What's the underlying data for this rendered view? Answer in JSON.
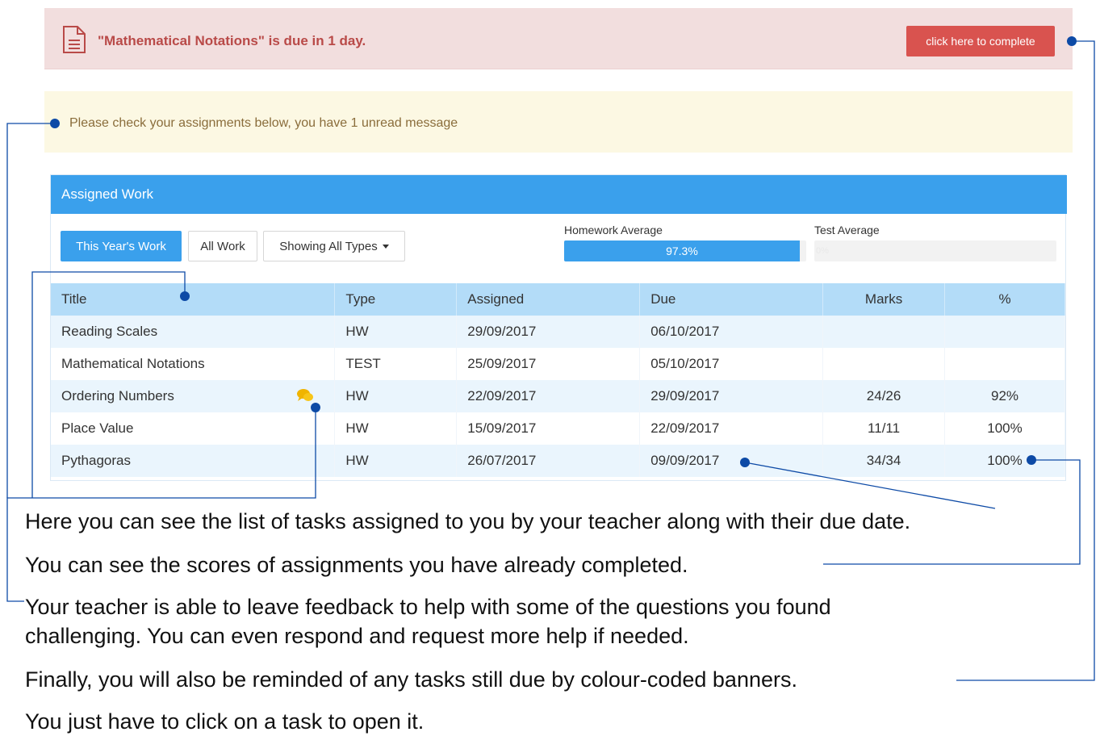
{
  "due_banner": {
    "text": "\"Mathematical Notations\" is due in 1 day.",
    "button_label": "click here to complete",
    "icon": "document-icon",
    "background": "#f2dede",
    "text_color": "#b94a48",
    "button_color": "#d9534f"
  },
  "info_banner": {
    "text": "Please check your assignments below, you have 1 unread message",
    "background": "#fcf8e3",
    "text_color": "#8a6d3b"
  },
  "panel": {
    "heading": "Assigned Work",
    "heading_color": "#3aa0ec",
    "filters": {
      "this_year": "This Year's Work",
      "all_work": "All Work",
      "types": "Showing All Types"
    },
    "homework_average": {
      "label": "Homework Average",
      "value_text": "97.3%",
      "fraction": 0.973
    },
    "test_average": {
      "label": "Test Average",
      "value_text": "0%",
      "fraction": 0.0
    }
  },
  "table": {
    "headers": [
      "Title",
      "Type",
      "Assigned",
      "Due",
      "Marks",
      "%"
    ],
    "rows": [
      {
        "title": "Reading Scales",
        "type": "HW",
        "assigned": "29/09/2017",
        "due": "06/10/2017",
        "marks": "",
        "percent": ""
      },
      {
        "title": "Mathematical Notations",
        "type": "TEST",
        "assigned": "25/09/2017",
        "due": "05/10/2017",
        "marks": "",
        "percent": ""
      },
      {
        "title": "Ordering Numbers",
        "type": "HW",
        "assigned": "22/09/2017",
        "due": "29/09/2017",
        "marks": "24/26",
        "percent": "92%",
        "feedback_icon": "chat-bubble-icon"
      },
      {
        "title": "Place Value",
        "type": "HW",
        "assigned": "15/09/2017",
        "due": "22/09/2017",
        "marks": "11/11",
        "percent": "100%"
      },
      {
        "title": "Pythagoras",
        "type": "HW",
        "assigned": "26/07/2017",
        "due": "09/09/2017",
        "marks": "34/34",
        "percent": "100%"
      }
    ]
  },
  "captions": {
    "tasks": "Here you can see the list of tasks assigned to you by your teacher along with their due date.",
    "scores": "You can see the scores of assignments you have already completed.",
    "feedback_line1": "Your teacher is able to leave feedback to help with some of the questions you found",
    "feedback_line2": "challenging. You can even respond and request more help if needed.",
    "banners": "Finally, you will also be reminded of any tasks still due by colour-coded banners.",
    "click": "You just have to click on a task to open it."
  },
  "annotation_color": "#0d4aa6"
}
